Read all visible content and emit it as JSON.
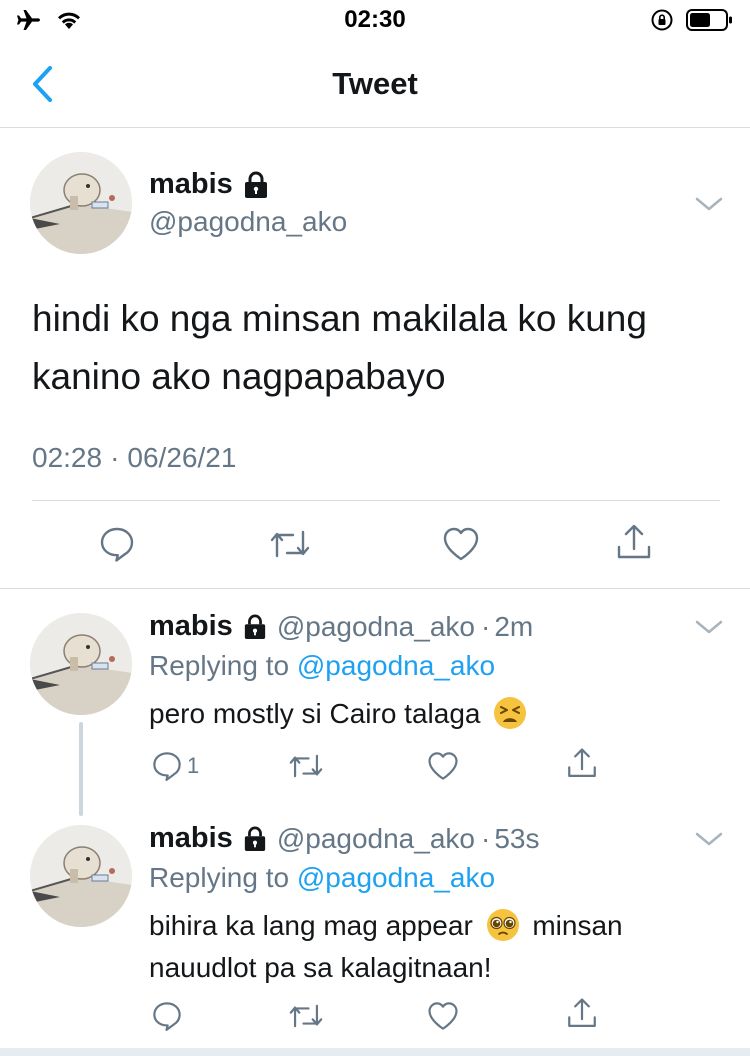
{
  "status_bar": {
    "time": "02:30"
  },
  "nav": {
    "title": "Tweet"
  },
  "main_tweet": {
    "name": "mabis",
    "handle": "@pagodna_ako",
    "text": "hindi ko nga minsan makilala ko kung kanino ako nagpapabayo",
    "time": "02:28",
    "separator": "·",
    "date": "06/26/21"
  },
  "replies": [
    {
      "name": "mabis",
      "handle": "@pagodna_ako",
      "separator": "·",
      "time": "2m",
      "replying_prefix": "Replying to",
      "replying_to": "@pagodna_ako",
      "text": "pero mostly si Cairo talaga",
      "emoji": "tired-face",
      "reply_count": "1"
    },
    {
      "name": "mabis",
      "handle": "@pagodna_ako",
      "separator": "·",
      "time": "53s",
      "replying_prefix": "Replying to",
      "replying_to": "@pagodna_ako",
      "text_before": "bihira ka lang mag appear",
      "emoji": "pleading-face",
      "text_after": "minsan nauudlot pa sa kalagitnaan!"
    }
  ],
  "colors": {
    "accent": "#1da1f2",
    "secondary": "#657786",
    "primary_text": "#14171a",
    "divider": "#d9dde1"
  }
}
